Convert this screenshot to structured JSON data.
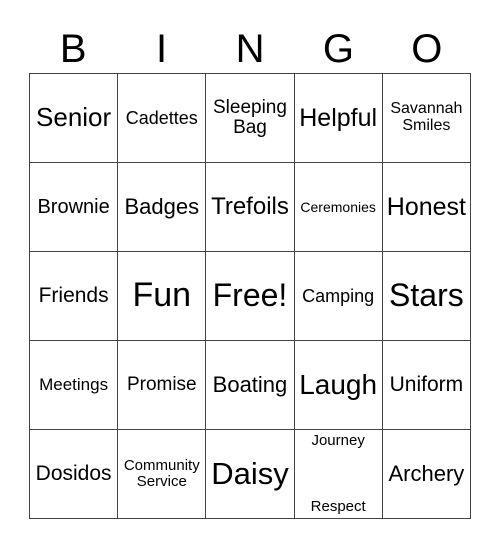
{
  "header": [
    "B",
    "I",
    "N",
    "G",
    "O"
  ],
  "rows": [
    [
      {
        "t": "Senior",
        "s": 26
      },
      {
        "t": "Cadettes",
        "s": 18
      },
      {
        "t": "Sleeping Bag",
        "s": 19
      },
      {
        "t": "Helpful",
        "s": 25
      },
      {
        "t": "Savannah Smiles",
        "s": 16
      }
    ],
    [
      {
        "t": "Brownie",
        "s": 20
      },
      {
        "t": "Badges",
        "s": 22
      },
      {
        "t": "Trefoils",
        "s": 24
      },
      {
        "t": "Ceremonies",
        "s": 14
      },
      {
        "t": "Honest",
        "s": 25
      }
    ],
    [
      {
        "t": "Friends",
        "s": 21
      },
      {
        "t": "Fun",
        "s": 34
      },
      {
        "t": "Free!",
        "s": 32
      },
      {
        "t": "Camping",
        "s": 18
      },
      {
        "t": "Stars",
        "s": 32
      }
    ],
    [
      {
        "t": "Meetings",
        "s": 17
      },
      {
        "t": "Promise",
        "s": 19
      },
      {
        "t": "Boating",
        "s": 22
      },
      {
        "t": "Laugh",
        "s": 28
      },
      {
        "t": "Uniform",
        "s": 21
      }
    ],
    [
      {
        "t": "Dosidos",
        "s": 21
      },
      {
        "t": "Community Service",
        "s": 15
      },
      {
        "t": "Daisy",
        "s": 31
      },
      {
        "t": "Journey|Respect",
        "s": 15
      },
      {
        "t": "Archery",
        "s": 22
      }
    ]
  ]
}
